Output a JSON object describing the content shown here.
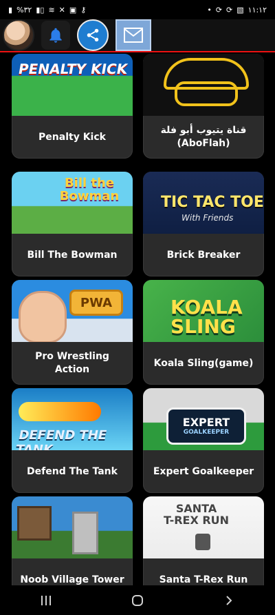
{
  "status_bar": {
    "battery": "%٣٢",
    "time": "١١:١٢"
  },
  "header": {
    "icons": [
      "avatar",
      "bell-icon",
      "share-icon",
      "mail-icon"
    ]
  },
  "games": [
    {
      "title": "Penalty Kick",
      "thumb_text": "PENALTY KICK"
    },
    {
      "title": "قناة يتيوب أبو فلة (AboFlah)",
      "thumb_text": ""
    },
    {
      "title": "Bill The Bowman",
      "thumb_text": "Bill the Bowman"
    },
    {
      "title": "Brick Breaker",
      "thumb_text": "TIC TAC TOE",
      "thumb_subtext": "With Friends"
    },
    {
      "title": "Pro Wrestling Action",
      "thumb_text": "PWA"
    },
    {
      "title": "Koala Sling(game)",
      "thumb_text": "KOALA SLING"
    },
    {
      "title": "Defend The Tank",
      "thumb_text": "DEFEND THE TANK"
    },
    {
      "title": "Expert Goalkeeper",
      "thumb_text": "EXPERT",
      "thumb_subtext": "GOALKEEPER"
    },
    {
      "title": "Noob Village Tower",
      "thumb_text": ""
    },
    {
      "title": "Santa T-Rex Run",
      "thumb_text": "SANTA",
      "thumb_subtext": "T-REX RUN"
    }
  ],
  "nav": {
    "recent_icon": "recent-apps-icon",
    "home_icon": "home-icon",
    "back_icon": "back-icon"
  },
  "colors": {
    "accent": "#e11",
    "card_bg": "#2b2b2b",
    "header_bg": "#111"
  }
}
